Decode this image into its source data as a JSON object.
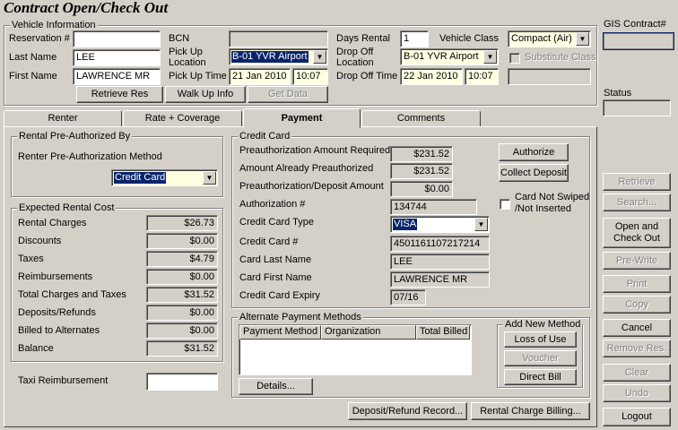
{
  "window": {
    "title": "Contract Open/Check Out"
  },
  "vehicle_info": {
    "group_title": "Vehicle Information",
    "reservation_label": "Reservation #",
    "reservation_value": "",
    "last_name_label": "Last Name",
    "last_name_value": "LEE",
    "first_name_label": "First Name",
    "first_name_value": "LAWRENCE MR",
    "bcn_label": "BCN",
    "bcn_value": "",
    "pickup_location_label": "Pick Up\nLocation",
    "pickup_location_value": "B-01 YVR Airport",
    "pickup_time_label": "Pick Up Time",
    "pickup_date": "21 Jan 2010",
    "pickup_time": "10:07",
    "days_rental_label": "Days Rental",
    "days_rental_value": "1",
    "vehicle_class_label": "Vehicle Class",
    "vehicle_class_value": "Compact (Air)",
    "dropoff_location_label": "Drop Off\nLocation",
    "dropoff_location_value": "B-01 YVR Airport",
    "substitute_class_label": "Substitute Class",
    "dropoff_time_label": "Drop Off Time",
    "dropoff_date": "22 Jan 2010",
    "dropoff_time": "10:07",
    "retrieve_res_label": "Retrieve Res",
    "walk_up_label": "Walk Up Info",
    "get_data_label": "Get Data"
  },
  "gis": {
    "label": "GIS Contract#",
    "value": ""
  },
  "status": {
    "label": "Status",
    "value": ""
  },
  "tabs": [
    {
      "label": "Renter"
    },
    {
      "label": "Rate + Coverage"
    },
    {
      "label": "Payment"
    },
    {
      "label": "Comments"
    }
  ],
  "preauth": {
    "group_title": "Rental Pre-Authorized By",
    "method_label": "Renter Pre-Authorization Method",
    "method_value": "Credit Card"
  },
  "expected_cost": {
    "group_title": "Expected Rental Cost",
    "rows": [
      {
        "label": "Rental Charges",
        "value": "$26.73"
      },
      {
        "label": "Discounts",
        "value": "$0.00"
      },
      {
        "label": "Taxes",
        "value": "$4.79"
      },
      {
        "label": "Reimbursements",
        "value": "$0.00"
      },
      {
        "label": "Total Charges and Taxes",
        "value": "$31.52"
      },
      {
        "label": "Deposits/Refunds",
        "value": "$0.00"
      },
      {
        "label": "Billed to Alternates",
        "value": "$0.00"
      },
      {
        "label": "Balance",
        "value": "$31.52"
      }
    ]
  },
  "taxi": {
    "label": "Taxi Reimbursement",
    "value": ""
  },
  "credit_card": {
    "group_title": "Credit Card",
    "preauth_required_label": "Preauthorization Amount Required",
    "preauth_required_value": "$231.52",
    "already_preauth_label": "Amount Already Preauthorized",
    "already_preauth_value": "$231.52",
    "deposit_amount_label": "Preauthorization/Deposit Amount",
    "deposit_amount_value": "$0.00",
    "authorization_label": "Authorization #",
    "authorization_value": "134744",
    "card_type_label": "Credit Card Type",
    "card_type_value": "VISA",
    "card_number_label": "Credit Card #",
    "card_number_value": "4501161107217214",
    "card_last_name_label": "Card Last Name",
    "card_last_name_value": "LEE",
    "card_first_name_label": "Card First Name",
    "card_first_name_value": "LAWRENCE MR",
    "card_expiry_label": "Credit Card Expiry",
    "card_expiry_value": "07/16",
    "authorize_label": "Authorize",
    "collect_deposit_label": "Collect Deposit",
    "not_swiped_label": "Card Not Swiped\n/Not Inserted"
  },
  "alt_payment": {
    "group_title": "Alternate Payment Methods",
    "columns": [
      "Payment Method",
      "Organization",
      "Total Billed"
    ],
    "details_label": "Details...",
    "add_new_title": "Add New Method",
    "loss_of_use_label": "Loss of Use",
    "voucher_label": "Voucher",
    "direct_bill_label": "Direct Bill"
  },
  "bottom_buttons": {
    "deposit_refund_label": "Deposit/Refund Record...",
    "rental_charge_label": "Rental Charge Billing..."
  },
  "side_buttons": {
    "retrieve": "Retrieve",
    "search": "Search...",
    "open_checkout": "Open and\nCheck Out",
    "prewrite": "Pre-Write",
    "print": "Print",
    "copy": "Copy",
    "cancel": "Cancel",
    "remove_res": "Remove Res.",
    "clear": "Clear",
    "undo": "Undo",
    "logout": "Logout"
  }
}
